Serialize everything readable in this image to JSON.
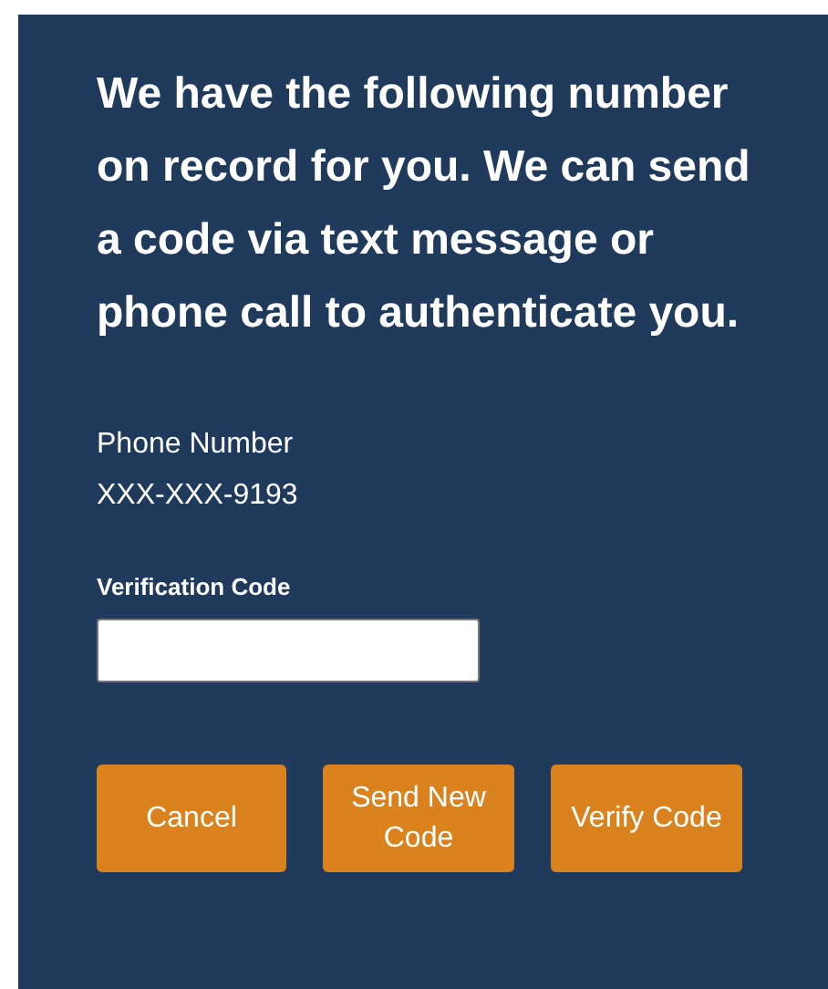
{
  "message": "We have the following number on record for you. We can send a code via text message or phone call to authenticate you.",
  "phone": {
    "label": "Phone Number",
    "value": "XXX-XXX-9193"
  },
  "verification": {
    "label": "Verification Code"
  },
  "buttons": [
    {
      "label": "Cancel"
    },
    {
      "label": "Send New Code"
    },
    {
      "label": "Verify Code"
    }
  ]
}
